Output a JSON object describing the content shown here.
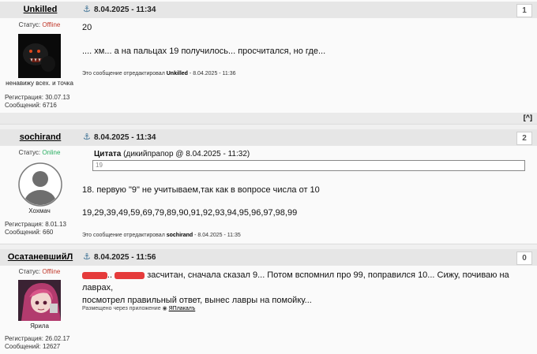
{
  "posts": [
    {
      "username": "Unkilled",
      "status_label": "Статус:",
      "status_value": "Offline",
      "date": "8.04.2025 - 11:34",
      "post_number": "1",
      "avatar_caption": "ненавижу всех. и точка",
      "reg_label": "Регистрация: 30.07.13",
      "msgs_label": "Сообщений: 6716",
      "lines": [
        "20",
        ".... хм... а на пальцах 19 получилось... просчитался, но где..."
      ],
      "edit_prefix": "Это сообщение отредактировал",
      "edit_user": "Unkilled",
      "edit_date": "- 8.04.2025 - 11:36"
    },
    {
      "username": "sochirand",
      "status_label": "Статус:",
      "status_value": "Online",
      "date": "8.04.2025 - 11:34",
      "post_number": "2",
      "avatar_caption": "Хохмач",
      "reg_label": "Регистрация: 8.01.13",
      "msgs_label": "Сообщений: 660",
      "quote_word": "Цитата",
      "quote_meta": "(дикийпрапор @ 8.04.2025 - 11:32)",
      "quote_text": "19",
      "lines": [
        "18. первую \"9\" не учитываем,так как в вопросе числа от 10",
        "19,29,39,49,59,69,79,89,90,91,92,93,94,95,96,97,98,99"
      ],
      "edit_prefix": "Это сообщение отредактировал",
      "edit_user": "sochirand",
      "edit_date": "- 8.04.2025 - 11:35"
    },
    {
      "username": "ОсатаневшийЛ",
      "status_label": "Статус:",
      "status_value": "Offline",
      "date": "8.04.2025 - 11:56",
      "post_number": "0",
      "avatar_caption": "Ярила",
      "reg_label": "Регистрация: 26.02.17",
      "msgs_label": "Сообщений: 12627",
      "sep1": "..",
      "text_line1": "засчитан, сначала сказал 9... Потом вспомнил про 99, поправился 10... Сижу, почиваю на лаврах,",
      "text_line2": "посмотрел правильный ответ, вынес лавры на помойку...",
      "app_prefix": "Размещено через приложение",
      "app_link": "ЯПлакалъ"
    }
  ],
  "top_link": "[^]",
  "colors": {
    "header_bg": "#e6e6e6",
    "offline": "#c0392b",
    "online": "#27ae60",
    "redaction": "#e53b3b"
  }
}
